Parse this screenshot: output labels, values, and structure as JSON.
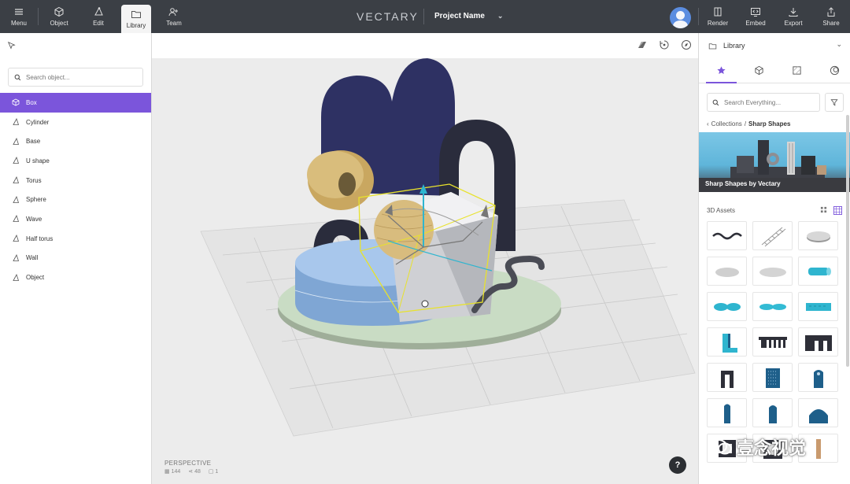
{
  "topbar": {
    "left_tools": [
      {
        "label": "Menu",
        "icon": "hamburger-icon"
      },
      {
        "label": "Object",
        "icon": "cube-icon"
      },
      {
        "label": "Edit",
        "icon": "vertex-edit-icon"
      },
      {
        "label": "Library",
        "icon": "folder-icon",
        "active": true
      },
      {
        "label": "Team",
        "icon": "team-add-icon"
      }
    ],
    "brand": "VECTARY",
    "project_name": "Project Name",
    "right_tools": [
      {
        "label": "Render",
        "icon": "render-icon"
      },
      {
        "label": "Embed",
        "icon": "embed-icon"
      },
      {
        "label": "Export",
        "icon": "download-icon"
      },
      {
        "label": "Share",
        "icon": "share-icon"
      }
    ]
  },
  "left_panel": {
    "search_placeholder": "Search object...",
    "objects": [
      {
        "label": "Box",
        "selected": true
      },
      {
        "label": "Cylinder"
      },
      {
        "label": "Base"
      },
      {
        "label": "U shape"
      },
      {
        "label": "Torus"
      },
      {
        "label": "Sphere"
      },
      {
        "label": "Wave"
      },
      {
        "label": "Half torus"
      },
      {
        "label": "Wall"
      },
      {
        "label": "Object"
      }
    ]
  },
  "viewport": {
    "camera_mode": "PERSPECTIVE",
    "stats": {
      "faces": "144",
      "vertices": "48",
      "objects": "1"
    },
    "help_label": "?"
  },
  "right_panel": {
    "header": "Library",
    "search_placeholder": "Search Everything...",
    "breadcrumb": {
      "parent": "Collections",
      "separator": "/",
      "current": "Sharp Shapes"
    },
    "banner_caption": "Sharp Shapes by Vectary",
    "assets_title": "3D Assets"
  },
  "watermark": "壹念视觉",
  "colors": {
    "accent": "#7b55db",
    "topbar": "#3b3f45",
    "navy": "#2e3163",
    "blue": "#8fb6e3",
    "gold": "#c9a760",
    "cyan": "#2fb5cf"
  }
}
